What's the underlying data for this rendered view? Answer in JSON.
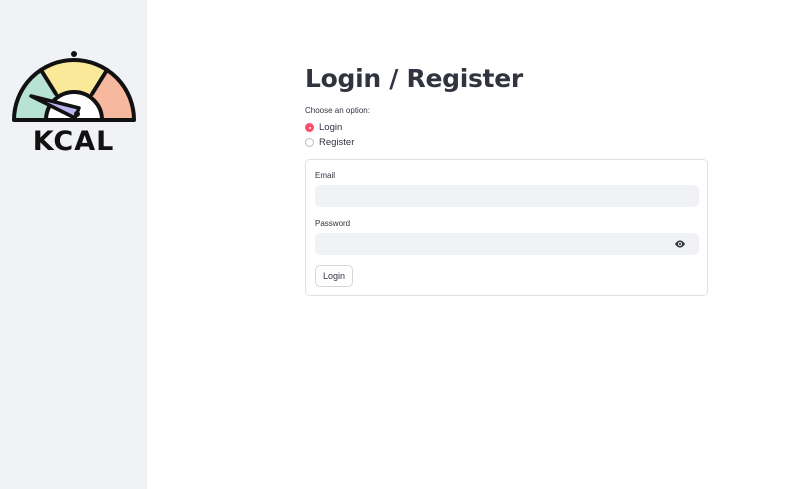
{
  "sidebar": {
    "logo_text": "KCAL",
    "logo_icon": "gauge-icon",
    "logo_colors": {
      "left": "#b6e3d3",
      "top": "#fbe99a",
      "right": "#f6b89f",
      "needle": "#b9b6f0",
      "outline": "#111111"
    }
  },
  "main": {
    "title": "Login / Register",
    "option_label": "Choose an option:",
    "options": [
      {
        "label": "Login",
        "selected": true
      },
      {
        "label": "Register",
        "selected": false
      }
    ],
    "form": {
      "email_label": "Email",
      "email_value": "",
      "password_label": "Password",
      "password_value": "",
      "password_toggle_icon": "eye-icon",
      "submit_label": "Login"
    }
  },
  "colors": {
    "accent": "#ff4b6b",
    "sidebar_bg": "#f0f2f6",
    "input_bg": "#f0f2f6",
    "text": "#31333f"
  }
}
